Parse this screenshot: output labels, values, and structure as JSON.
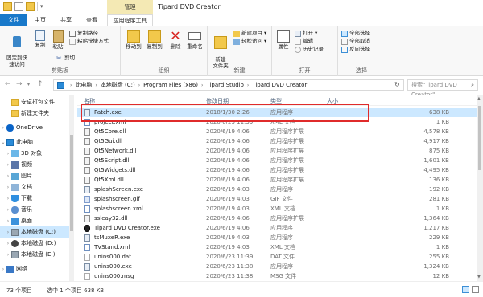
{
  "window": {
    "title": "Tipard DVD Creator",
    "manage_tab": "管理"
  },
  "tabs": {
    "file": "文件",
    "home": "主页",
    "share": "共享",
    "view": "查看",
    "app_tools": "应用程序工具"
  },
  "ribbon": {
    "clipboard": {
      "label": "剪贴板",
      "pin": "固定到快\n速访问",
      "copy": "复制",
      "paste": "粘贴",
      "copy_path": "复制路径",
      "paste_shortcut": "粘贴快捷方式",
      "cut": "剪切"
    },
    "organize": {
      "label": "组织",
      "move_to": "移动到",
      "copy_to": "复制到",
      "delete": "删除",
      "rename": "重命名"
    },
    "new": {
      "label": "新建",
      "new_folder": "新建\n文件夹",
      "new_item": "新建项目",
      "easy_access": "轻松访问"
    },
    "open": {
      "label": "打开",
      "properties": "属性",
      "open": "打开",
      "edit": "编辑",
      "history": "历史记录"
    },
    "select": {
      "label": "选择",
      "select_all": "全部选择",
      "select_none": "全部取消",
      "invert": "反向选择"
    }
  },
  "address": {
    "crumbs": [
      "此电脑",
      "本地磁盘 (C:)",
      "Program Files (x86)",
      "Tipard Studio",
      "Tipard DVD Creator"
    ],
    "search_placeholder": "搜索\"Tipard DVD Creator\""
  },
  "nav": {
    "items": [
      {
        "label": "安卓打包文件",
        "icon": "folder-icon",
        "indent": 1
      },
      {
        "label": "新建文件夹",
        "icon": "folder-icon",
        "indent": 1
      },
      {
        "label": "OneDrive",
        "icon": "onedrive-icon",
        "indent": 0
      },
      {
        "label": "此电脑",
        "icon": "pc-icon",
        "indent": 0
      },
      {
        "label": "3D 对象",
        "icon": "3d-objects-icon",
        "indent": 1
      },
      {
        "label": "视频",
        "icon": "video-icon",
        "indent": 1
      },
      {
        "label": "图片",
        "icon": "pictures-icon",
        "indent": 1
      },
      {
        "label": "文档",
        "icon": "documents-icon",
        "indent": 1
      },
      {
        "label": "下载",
        "icon": "downloads-icon",
        "indent": 1
      },
      {
        "label": "音乐",
        "icon": "music-icon",
        "indent": 1
      },
      {
        "label": "桌面",
        "icon": "desktop-icon",
        "indent": 1
      },
      {
        "label": "本地磁盘 (C:)",
        "icon": "drive-icon",
        "indent": 1
      },
      {
        "label": "本地磁盘 (D:)",
        "icon": "dvd-drive-icon",
        "indent": 1
      },
      {
        "label": "本地磁盘 (E:)",
        "icon": "drive-icon",
        "indent": 1
      },
      {
        "label": "网络",
        "icon": "network-icon",
        "indent": 0
      }
    ]
  },
  "list": {
    "columns": {
      "name": "名称",
      "date": "修改日期",
      "type": "类型",
      "size": "大小"
    },
    "rows": [
      {
        "name": "Patch.exe",
        "date": "2018/1/30 2:26",
        "type": "应用程序",
        "size": "638 KB",
        "icon": "exe"
      },
      {
        "name": "project.xml",
        "date": "2020/6/23 11:39",
        "type": "XML 文档",
        "size": "1 KB",
        "icon": "xml"
      },
      {
        "name": "Qt5Core.dll",
        "date": "2020/6/19 4:06",
        "type": "应用程序扩展",
        "size": "4,578 KB",
        "icon": "dll"
      },
      {
        "name": "Qt5Gui.dll",
        "date": "2020/6/19 4:06",
        "type": "应用程序扩展",
        "size": "4,917 KB",
        "icon": "dll"
      },
      {
        "name": "Qt5Network.dll",
        "date": "2020/6/19 4:06",
        "type": "应用程序扩展",
        "size": "875 KB",
        "icon": "dll"
      },
      {
        "name": "Qt5Script.dll",
        "date": "2020/6/19 4:06",
        "type": "应用程序扩展",
        "size": "1,601 KB",
        "icon": "dll"
      },
      {
        "name": "Qt5Widgets.dll",
        "date": "2020/6/19 4:06",
        "type": "应用程序扩展",
        "size": "4,495 KB",
        "icon": "dll"
      },
      {
        "name": "Qt5Xml.dll",
        "date": "2020/6/19 4:06",
        "type": "应用程序扩展",
        "size": "136 KB",
        "icon": "dll"
      },
      {
        "name": "splashScreen.exe",
        "date": "2020/6/19 4:03",
        "type": "应用程序",
        "size": "192 KB",
        "icon": "exe"
      },
      {
        "name": "splashscreen.gif",
        "date": "2020/6/19 4:03",
        "type": "GIF 文件",
        "size": "281 KB",
        "icon": "gif"
      },
      {
        "name": "splashscreen.xml",
        "date": "2020/6/19 4:03",
        "type": "XML 文档",
        "size": "1 KB",
        "icon": "xml"
      },
      {
        "name": "ssleay32.dll",
        "date": "2020/6/19 4:06",
        "type": "应用程序扩展",
        "size": "1,364 KB",
        "icon": "dll"
      },
      {
        "name": "Tipard DVD Creator.exe",
        "date": "2020/6/19 4:06",
        "type": "应用程序",
        "size": "1,217 KB",
        "icon": "tdvd"
      },
      {
        "name": "tsMuxeR.exe",
        "date": "2020/6/19 4:03",
        "type": "应用程序",
        "size": "229 KB",
        "icon": "exe"
      },
      {
        "name": "TVStand.xml",
        "date": "2020/6/19 4:03",
        "type": "XML 文档",
        "size": "1 KB",
        "icon": "xml"
      },
      {
        "name": "unins000.dat",
        "date": "2020/6/23 11:39",
        "type": "DAT 文件",
        "size": "255 KB",
        "icon": "dat"
      },
      {
        "name": "unins000.exe",
        "date": "2020/6/23 11:38",
        "type": "应用程序",
        "size": "1,324 KB",
        "icon": "exe"
      },
      {
        "name": "unins000.msg",
        "date": "2020/6/23 11:38",
        "type": "MSG 文件",
        "size": "12 KB",
        "icon": "dat"
      }
    ]
  },
  "status": {
    "count": "73 个项目",
    "selection": "选中 1 个项目  638 KB"
  }
}
